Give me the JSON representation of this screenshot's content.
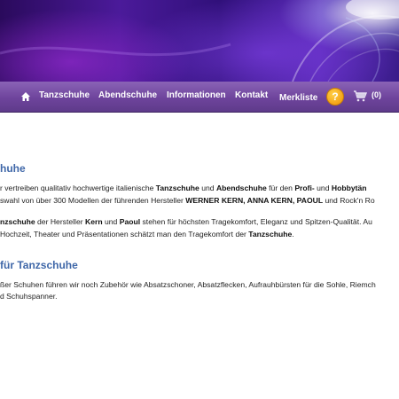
{
  "nav": {
    "items": [
      "Tanzschuhe",
      "Abendschuhe",
      "Informationen",
      "Kontakt",
      "Merkliste"
    ],
    "help_symbol": "?",
    "cart_count": "(0)"
  },
  "section1": {
    "heading": "huhe",
    "p1_line1": {
      "a": "r vertreiben qualitativ hochwertige italienische ",
      "b": "Tanzschuhe",
      "c": " und ",
      "d": "Abendschuhe",
      "e": " für den ",
      "f": "Profi-",
      "g": " und ",
      "h": "Hobbytän"
    },
    "p1_line2": {
      "a": "swahl von über 300 Modellen der führenden Hersteller ",
      "b": "WERNER KERN, ANNA KERN, PAOUL",
      "c": " und Rock'n Ro"
    },
    "p2_line1": {
      "a": "nzschuhe",
      "b": " der Hersteller ",
      "c": "Kern",
      "d": " und ",
      "e": "Paoul",
      "f": " stehen für höchsten Tragekomfort, Eleganz und Spitzen-Qualität. Au"
    },
    "p2_line2": {
      "a": " Hochzeit, Theater und Präsentationen schätzt man den Tragekomfort der ",
      "b": "Tanzschuhe",
      "c": "."
    }
  },
  "section2": {
    "heading": " für Tanzschuhe",
    "p_line1": "ßer Schuhen führen wir noch Zubehör wie Absatzschoner, Absatzflecken, Aufrauhbürsten für die Sohle, Riemch",
    "p_line2": "d Schuhspanner."
  },
  "colors": {
    "nav_bg": "#6e449c",
    "heading": "#3f67a8",
    "help_icon": "#f3a316"
  }
}
